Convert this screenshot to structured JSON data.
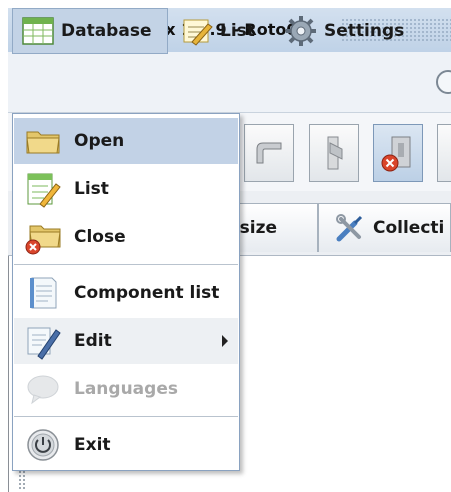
{
  "window": {
    "title": "Roto - Simplex 1.2.9  - Roto00"
  },
  "menubar": {
    "database": "Database",
    "list": "List",
    "settings": "Settings"
  },
  "tabs": {
    "resize": "Resize",
    "collections": "Collecti"
  },
  "dropdown": {
    "items": [
      {
        "label": "Open",
        "icon": "folder-open-icon"
      },
      {
        "label": "List",
        "icon": "list-edit-icon"
      },
      {
        "label": "Close",
        "icon": "folder-close-icon"
      },
      {
        "label": "Component list",
        "icon": "notepad-icon"
      },
      {
        "label": "Edit",
        "icon": "edit-pencil-icon"
      },
      {
        "label": "Languages",
        "icon": "speech-bubble-icon"
      },
      {
        "label": "Exit",
        "icon": "power-icon"
      }
    ]
  },
  "colors": {
    "menu_highlight": "#c2d2e6",
    "title_bar": "#c9d9eb",
    "disabled_text": "#a9a9a9",
    "close_badge": "#d9452b"
  }
}
